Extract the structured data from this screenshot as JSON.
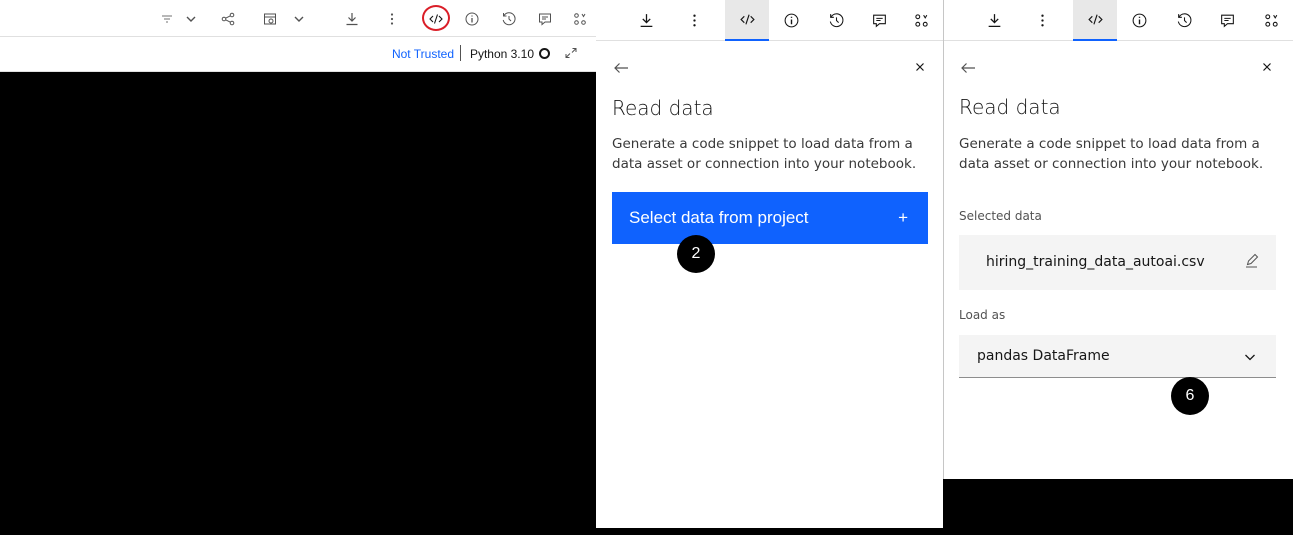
{
  "notebook": {
    "status": {
      "trust_label": "Not Trusted",
      "kernel_label": "Python 3.10"
    },
    "toolbar_icons": [
      "filter-icon",
      "chevron-down-icon",
      "share-icon",
      "schedule-icon",
      "chevron-down-icon",
      "download-icon",
      "overflow-menu-icon",
      "code-snippet-icon",
      "info-icon",
      "history-icon",
      "comment-icon",
      "data-icon"
    ]
  },
  "panel_tabs": [
    "download-icon",
    "overflow-menu-icon",
    "code-snippet-icon",
    "info-icon",
    "history-icon",
    "comment-icon",
    "data-icon"
  ],
  "read_data_step1": {
    "title": "Read data",
    "description_line1": "Generate a code snippet to load data from a",
    "description_line2": "data asset or connection into your notebook.",
    "select_button_label": "Select data from project",
    "select_button_icon": "+",
    "step_badge": "2"
  },
  "read_data_step2": {
    "title": "Read data",
    "description_line1": "Generate a code snippet to load data from a",
    "description_line2": "data asset or connection into your notebook.",
    "selected_data_label": "Selected data",
    "selected_file": "hiring_training_data_autoai.csv",
    "load_as_label": "Load as",
    "load_as_value": "pandas DataFrame",
    "step_badge": "6"
  },
  "colors": {
    "accent": "#0f62fe",
    "highlight_circle": "#da1e28",
    "badge": "#000000"
  }
}
